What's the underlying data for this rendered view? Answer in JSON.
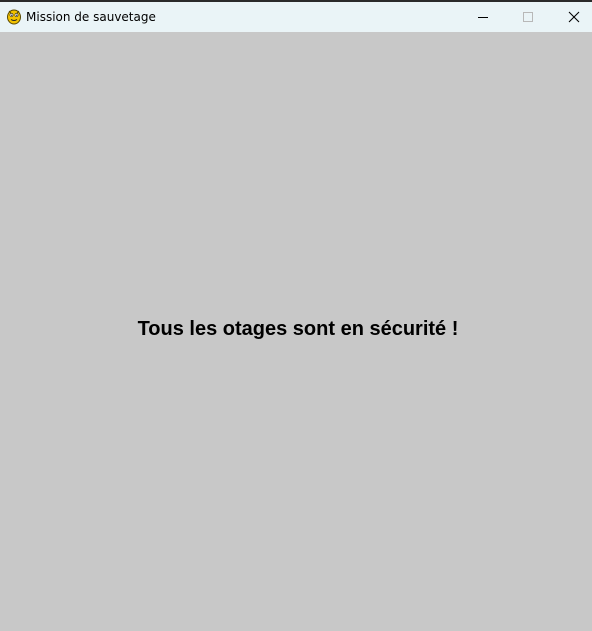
{
  "window": {
    "title": "Mission de sauvetage",
    "app_icon": "pygame-snake-icon"
  },
  "controls": {
    "minimize_icon": "minimize-icon",
    "maximize_icon": "maximize-icon",
    "close_icon": "close-icon"
  },
  "game": {
    "background_color": "#c8c8c8",
    "message": "Tous les otages sont en sécurité !"
  }
}
